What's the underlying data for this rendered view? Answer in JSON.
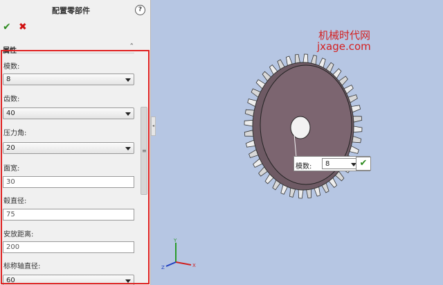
{
  "panel": {
    "title": "配置零部件",
    "help_glyph": "?",
    "ok_glyph": "✔",
    "cancel_glyph": "✖",
    "section": {
      "label": "属性",
      "collapse_glyph": "⌃"
    },
    "fields": [
      {
        "label": "模数:",
        "type": "select",
        "value": "8"
      },
      {
        "label": "齿数:",
        "type": "select",
        "value": "40"
      },
      {
        "label": "压力角:",
        "type": "select",
        "value": "20"
      },
      {
        "label": "面宽:",
        "type": "text",
        "value": "30"
      },
      {
        "label": "毂直径:",
        "type": "text",
        "value": "75"
      },
      {
        "label": "安放距离:",
        "type": "text",
        "value": "200"
      },
      {
        "label": "标称轴直径:",
        "type": "select",
        "value": "60"
      }
    ]
  },
  "viewport": {
    "watermark_line1": "机械时代网",
    "watermark_line2": "jxage.com",
    "callout": {
      "label": "模数:",
      "value": "8",
      "ok_glyph": "✔"
    },
    "triad": {
      "x": "X",
      "y": "Y",
      "z": "Z"
    }
  },
  "colors": {
    "accent_frame": "#e02020",
    "viewport_bg": "#b6c6e3",
    "gear_face": "#7c6570",
    "ok_green": "#2c8a1e",
    "cancel_red": "#d01010"
  }
}
